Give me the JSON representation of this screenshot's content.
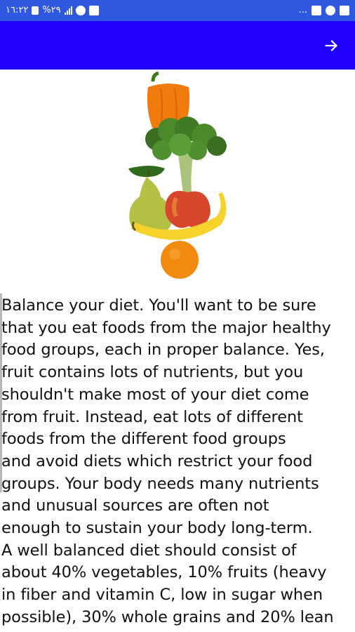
{
  "status_bar": {
    "time": "١٦:٢٢",
    "battery": "%٢٩",
    "overflow": "...",
    "icons_left": [
      "battery-icon",
      "signal-icon",
      "settings-icon",
      "mute-icon"
    ],
    "icons_right": [
      "cast-icon",
      "headphones-icon",
      "image-icon"
    ]
  },
  "app_bar": {
    "color": "#1f00ff",
    "action_icon": "arrow-right-icon"
  },
  "image": {
    "subject": "stacked fruits and vegetables"
  },
  "content": {
    "text": "Balance your diet. You'll want to be sure\nthat you eat foods from the major healthy\nfood groups, each in proper balance. Yes,\nfruit contains lots of nutrients, but you\nshouldn't make most of your diet come\nfrom fruit. Instead, eat lots of different\nfoods from the different food groups\nand avoid diets which restrict your food\ngroups. Your body needs many nutrients\nand unusual sources are often not\nenough to sustain your body long-term.\nA well balanced diet should consist of\nabout 40% vegetables, 10% fruits (heavy\nin fiber and vitamin C, low in sugar when\npossible), 30% whole grains and 20% lean"
  }
}
